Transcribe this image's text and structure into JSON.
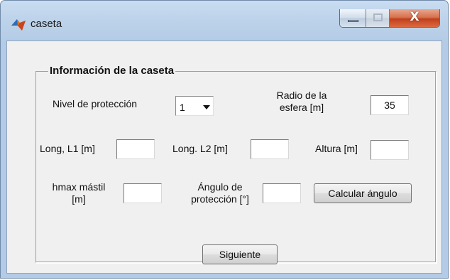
{
  "window": {
    "title": "caseta",
    "close_glyph": "X"
  },
  "panel": {
    "title": "Información de la caseta",
    "nivel_label": "Nivel de protección",
    "nivel_value": "1",
    "radio_label_line1": "Radio de la",
    "radio_label_line2": "esfera [m]",
    "radio_value": "35",
    "l1_label": "Long, L1 [m]",
    "l1_value": "",
    "l2_label": "Long. L2 [m]",
    "l2_value": "",
    "altura_label": "Altura [m]",
    "altura_value": "",
    "hmax_label_line1": "hmax mástil",
    "hmax_label_line2": "[m]",
    "hmax_value": "",
    "angulo_label_line1": "Ángulo de",
    "angulo_label_line2": "protección [°]",
    "angulo_value": "",
    "calcular_button": "Calcular ángulo"
  },
  "footer": {
    "siguiente_button": "Siguiente"
  },
  "icons": {
    "app": "matlab-icon",
    "minimize": "minimize-icon",
    "maximize": "maximize-icon",
    "close": "close-icon",
    "dropdown": "chevron-down-icon"
  }
}
